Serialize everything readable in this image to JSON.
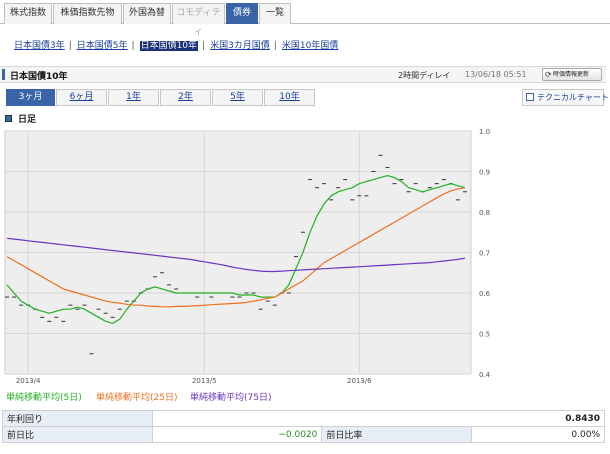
{
  "category_tabs": [
    {
      "label": "株式指数",
      "state": "normal"
    },
    {
      "label": "株価指数先物",
      "state": "normal"
    },
    {
      "label": "外国為替",
      "state": "normal"
    },
    {
      "label": "コモディティ",
      "state": "disabled"
    },
    {
      "label": "債券",
      "state": "active"
    },
    {
      "label": "一覧",
      "state": "normal"
    }
  ],
  "bond_links": [
    {
      "label": "日本国債3年"
    },
    {
      "label": "日本国債5年"
    },
    {
      "label": "日本国債10年",
      "current": true
    },
    {
      "label": "米国3カ月国債"
    },
    {
      "label": "米国10年国債"
    }
  ],
  "title_bar": {
    "title": "日本国債10年",
    "delay": "2時間ディレイ",
    "timestamp": "13/06/18 05:51",
    "refresh_label": "時価情報更新",
    "refresh_icon": "refresh-icon"
  },
  "period_tabs": [
    {
      "label": "3ヶ月",
      "active": true
    },
    {
      "label": "6ヶ月"
    },
    {
      "label": "1年"
    },
    {
      "label": "2年"
    },
    {
      "label": "5年"
    },
    {
      "label": "10年"
    }
  ],
  "technical_chart_label": "テクニカルチャート",
  "chart_section_label": "日足",
  "chart_data": {
    "type": "line",
    "ylim": [
      0.4,
      1.0
    ],
    "y_ticks": [
      "0.4",
      "0.5",
      "0.6",
      "0.7",
      "0.8",
      "0.9",
      "1.0"
    ],
    "x_ticks": [
      "2013/4",
      "2013/5",
      "2013/6"
    ],
    "grid": true,
    "candles": {
      "name": "",
      "values": [
        0.59,
        0.59,
        0.57,
        0.57,
        0.56,
        0.54,
        0.53,
        0.54,
        0.53,
        0.57,
        0.56,
        0.57,
        0.45,
        0.56,
        0.55,
        0.54,
        0.56,
        0.58,
        0.58,
        0.6,
        0.61,
        0.64,
        0.65,
        0.62,
        0.61,
        0.6,
        0.6,
        0.59,
        0.6,
        0.59,
        0.6,
        0.6,
        0.59,
        0.59,
        0.6,
        0.6,
        0.56,
        0.58,
        0.57,
        0.6,
        0.6,
        0.69,
        0.75,
        0.88,
        0.86,
        0.87,
        0.83,
        0.86,
        0.88,
        0.83,
        0.84,
        0.84,
        0.9,
        0.94,
        0.91,
        0.87,
        0.88,
        0.85,
        0.87,
        0.85,
        0.86,
        0.87,
        0.88,
        0.87,
        0.83,
        0.85
      ]
    },
    "series": [
      {
        "name": "単純移動平均(5日)",
        "color": "#22b022",
        "values": [
          0.62,
          0.6,
          0.58,
          0.57,
          0.56,
          0.555,
          0.55,
          0.555,
          0.56,
          0.56,
          0.565,
          0.56,
          0.55,
          0.54,
          0.53,
          0.525,
          0.535,
          0.56,
          0.58,
          0.6,
          0.61,
          0.615,
          0.61,
          0.605,
          0.6,
          0.6,
          0.6,
          0.6,
          0.6,
          0.6,
          0.6,
          0.6,
          0.6,
          0.595,
          0.595,
          0.595,
          0.59,
          0.59,
          0.59,
          0.6,
          0.62,
          0.66,
          0.7,
          0.75,
          0.79,
          0.82,
          0.84,
          0.85,
          0.855,
          0.86,
          0.87,
          0.875,
          0.88,
          0.885,
          0.89,
          0.885,
          0.875,
          0.86,
          0.855,
          0.85,
          0.855,
          0.86,
          0.865,
          0.87,
          0.865,
          0.86
        ]
      },
      {
        "name": "単純移動平均(25日)",
        "color": "#f07020",
        "values": [
          0.69,
          0.68,
          0.67,
          0.66,
          0.65,
          0.64,
          0.63,
          0.62,
          0.61,
          0.605,
          0.6,
          0.595,
          0.59,
          0.585,
          0.58,
          0.577,
          0.575,
          0.572,
          0.57,
          0.57,
          0.568,
          0.567,
          0.566,
          0.566,
          0.567,
          0.567,
          0.568,
          0.569,
          0.57,
          0.571,
          0.572,
          0.573,
          0.574,
          0.575,
          0.577,
          0.58,
          0.583,
          0.587,
          0.59,
          0.6,
          0.61,
          0.62,
          0.63,
          0.645,
          0.66,
          0.675,
          0.685,
          0.695,
          0.705,
          0.715,
          0.725,
          0.735,
          0.745,
          0.755,
          0.765,
          0.775,
          0.785,
          0.795,
          0.805,
          0.815,
          0.825,
          0.835,
          0.845,
          0.852,
          0.857,
          0.86
        ]
      },
      {
        "name": "単純移動平均(75日)",
        "color": "#6a35c0",
        "values": [
          0.735,
          0.733,
          0.731,
          0.729,
          0.727,
          0.725,
          0.723,
          0.721,
          0.719,
          0.717,
          0.715,
          0.713,
          0.711,
          0.709,
          0.707,
          0.705,
          0.703,
          0.701,
          0.699,
          0.697,
          0.695,
          0.693,
          0.691,
          0.689,
          0.687,
          0.685,
          0.683,
          0.68,
          0.677,
          0.674,
          0.671,
          0.668,
          0.664,
          0.661,
          0.658,
          0.656,
          0.654,
          0.653,
          0.653,
          0.654,
          0.655,
          0.656,
          0.657,
          0.658,
          0.659,
          0.66,
          0.661,
          0.662,
          0.663,
          0.664,
          0.665,
          0.666,
          0.667,
          0.668,
          0.669,
          0.67,
          0.671,
          0.672,
          0.673,
          0.674,
          0.675,
          0.677,
          0.679,
          0.681,
          0.683,
          0.686
        ]
      }
    ]
  },
  "stats": {
    "yield_label": "年利回り",
    "yield_value": "0.8430",
    "change_label": "前日比",
    "change_value": "−0.0020",
    "change_pct_label": "前日比率",
    "change_pct_value": "0.00%"
  }
}
